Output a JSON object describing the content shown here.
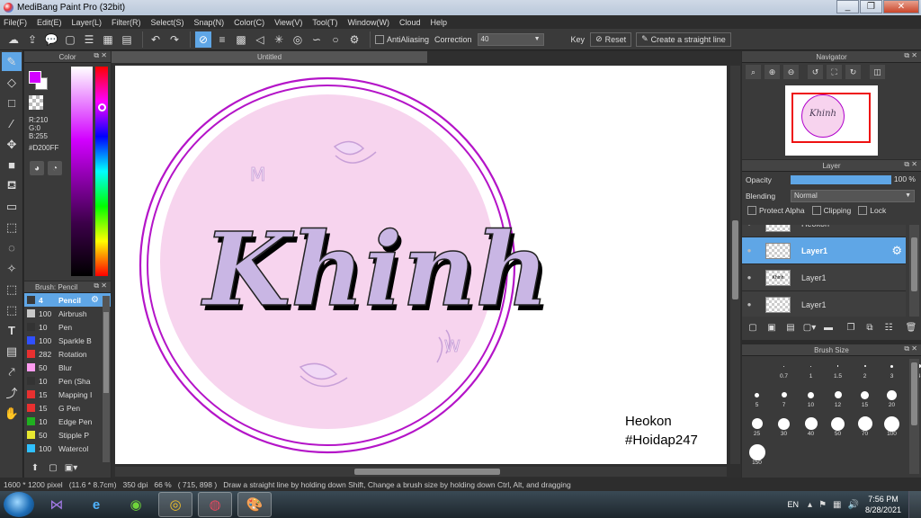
{
  "window": {
    "title": "MediBang Paint Pro (32bit)",
    "minimize": "_",
    "maximize": "❐",
    "close": "✕"
  },
  "menu": [
    "File(F)",
    "Edit(E)",
    "Layer(L)",
    "Filter(R)",
    "Select(S)",
    "Snap(N)",
    "Color(C)",
    "View(V)",
    "Tool(T)",
    "Window(W)",
    "Cloud",
    "Help"
  ],
  "toolbar": {
    "antialiasing_label": "AntiAliasing",
    "correction_label": "Correction",
    "correction_value": "40",
    "key_label": "Key",
    "reset_label": "Reset",
    "straight_line_label": "Create a straight line"
  },
  "color_panel": {
    "title": "Color",
    "r": "R:210",
    "g": "G:0",
    "b": "B:255",
    "hex": "#D200FF",
    "foreground": "#D200FF"
  },
  "brush_panel": {
    "title": "Brush: Pencil",
    "items": [
      {
        "size": "4",
        "name": "Pencil",
        "color": "#3a3a3a",
        "selected": true
      },
      {
        "size": "100",
        "name": "Airbrush",
        "color": "#c8c8c8",
        "selected": false
      },
      {
        "size": "10",
        "name": "Pen",
        "color": "#333333",
        "selected": false
      },
      {
        "size": "100",
        "name": "Sparkle B",
        "color": "#3050ff",
        "selected": false
      },
      {
        "size": "282",
        "name": "Rotation",
        "color": "#e83030",
        "selected": false
      },
      {
        "size": "50",
        "name": "Blur",
        "color": "#ff9cf0",
        "selected": false
      },
      {
        "size": "10",
        "name": "Pen (Sha",
        "color": "#333333",
        "selected": false
      },
      {
        "size": "15",
        "name": "Mapping I",
        "color": "#e83030",
        "selected": false
      },
      {
        "size": "15",
        "name": "G Pen",
        "color": "#e83030",
        "selected": false
      },
      {
        "size": "10",
        "name": "Edge Pen",
        "color": "#20b020",
        "selected": false
      },
      {
        "size": "50",
        "name": "Stipple P",
        "color": "#e8e830",
        "selected": false
      },
      {
        "size": "100",
        "name": "Watercol",
        "color": "#30c0ff",
        "selected": false
      }
    ]
  },
  "document": {
    "tab_title": "Untitled",
    "artwork_text": "Khinh",
    "signature_line1": "Heokon",
    "signature_line2": "#Hoidap247"
  },
  "status": {
    "size": "1600 * 1200 pixel",
    "physical": "(11.6 * 8.7cm)",
    "dpi": "350 dpi",
    "zoom": "66 %",
    "cursor": "( 715, 898 )",
    "hint": "Draw a straight line by holding down Shift, Change a brush size by holding down Ctrl, Alt, and dragging"
  },
  "navigator": {
    "title": "Navigator",
    "thumb_text": "Khinh"
  },
  "layer_panel": {
    "title": "Layer",
    "opacity_label": "Opacity",
    "opacity_value": "100 %",
    "opacity": 1.0,
    "blending_label": "Blending",
    "blending_value": "Normal",
    "protect_alpha": "Protect Alpha",
    "clipping": "Clipping",
    "lock": "Lock",
    "layers": [
      {
        "name": "Heokon",
        "selected": false,
        "thumb": "Heokon"
      },
      {
        "name": "Layer1",
        "selected": true,
        "thumb": ""
      },
      {
        "name": "Layer1",
        "selected": false,
        "thumb": "Khinh"
      },
      {
        "name": "Layer1",
        "selected": false,
        "thumb": ""
      }
    ]
  },
  "brush_size": {
    "title": "Brush Size",
    "sizes": [
      "0.7",
      "1",
      "1.5",
      "2",
      "3",
      "4",
      "5",
      "7",
      "10",
      "12",
      "15",
      "20",
      "25",
      "30",
      "40",
      "50",
      "70",
      "100",
      "150"
    ]
  },
  "taskbar": {
    "language": "EN",
    "time": "7:56 PM",
    "date": "8/28/2021"
  }
}
